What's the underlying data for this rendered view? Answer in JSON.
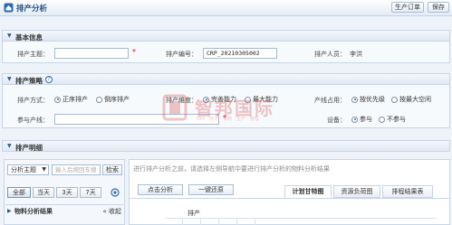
{
  "header": {
    "title": "排产分析",
    "buttons": [
      "生产订单",
      "保存"
    ]
  },
  "basic_info": {
    "title": "基本信息",
    "fields": {
      "topic_label": "排产主题：",
      "topic_value": "",
      "topic_required": "*",
      "code_label": "排产编号：",
      "code_value": "CRP_20210305002",
      "person_label": "排产人员：",
      "person_value": "李洪"
    }
  },
  "strategy": {
    "title": "排产策略",
    "help_icon": "?",
    "mode_label": "排产方式：",
    "mode_options": [
      "正序排产",
      "倒序排产"
    ],
    "mode_selected": 0,
    "dimension_label": "排产維度：",
    "dimension_options": [
      "完善能力",
      "最大能力"
    ],
    "dimension_selected": 0,
    "line_label": "产线占用：",
    "line_options": [
      "按优先级",
      "按最大空闲"
    ],
    "line_selected": 0,
    "participate_line_label": "参与产线：",
    "participate_line_required": "*",
    "equipment_label": "设备：",
    "equipment_options": [
      "参与",
      "不参与"
    ],
    "equipment_selected": 0
  },
  "watermark": {
    "main": "智邦国际",
    "sub": "ERP · 软件 · 系统 · 生产 · 管理"
  },
  "detail": {
    "title": "排产明细",
    "left": {
      "topic_select": "分析主题",
      "search_placeholder": "输入后按回车搜",
      "search_button": "检索",
      "range_tabs": [
        "全部",
        "当天",
        "3天",
        "7天"
      ],
      "result_title": "物料分析结果",
      "collapse_label": "收起"
    },
    "right": {
      "hint": "进行排产分析之前，请选择左侧导航中要进行排产分析的物料分析结果",
      "action_buttons": [
        "点击分析",
        "一键还原"
      ],
      "tabs": [
        "计划甘特图",
        "资源负荷图",
        "排程结果表"
      ],
      "active_tab": 0,
      "table_header": "排产"
    }
  }
}
